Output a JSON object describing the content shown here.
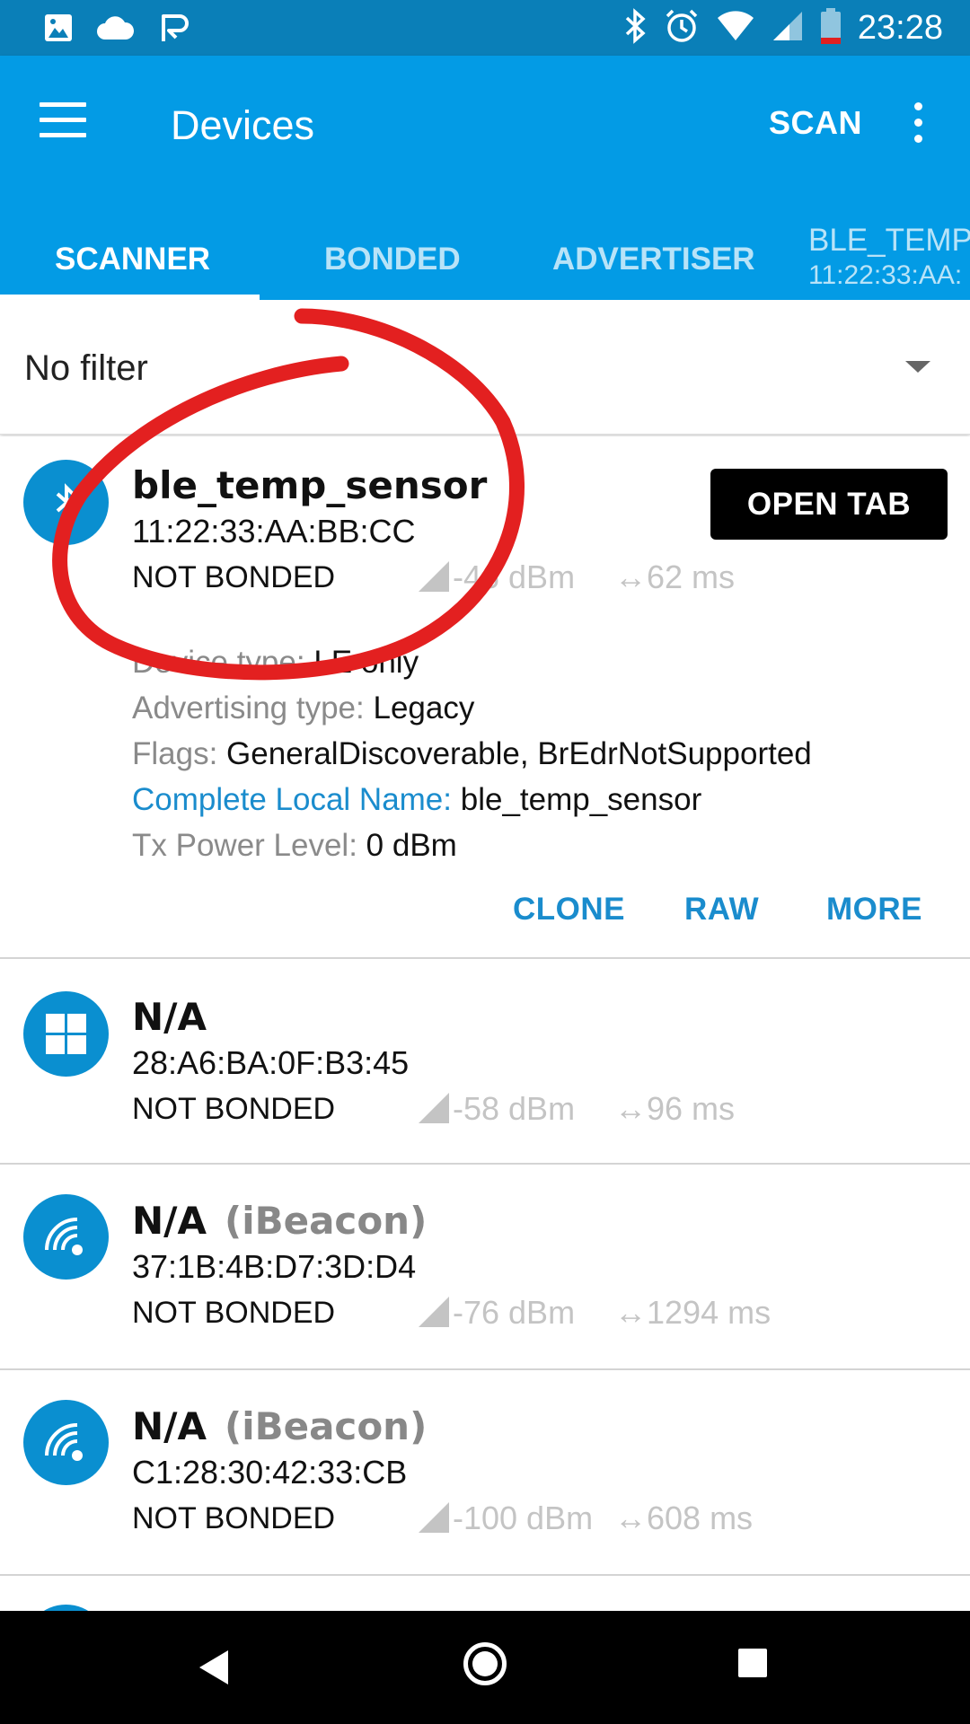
{
  "status_bar": {
    "time": "23:28",
    "left_icons": [
      "image-icon",
      "cloud-icon",
      "app-icon"
    ],
    "right_icons": [
      "bluetooth-icon",
      "alarm-icon",
      "wifi-icon",
      "signal-icon",
      "battery-icon"
    ]
  },
  "app_bar": {
    "title": "Devices",
    "scan_label": "SCAN"
  },
  "tabs": [
    {
      "label": "SCANNER",
      "active": true
    },
    {
      "label": "BONDED",
      "active": false
    },
    {
      "label": "ADVERTISER",
      "active": false
    },
    {
      "label": "BLE_TEMP_",
      "sublabel": "11:22:33:AA:",
      "active": false
    }
  ],
  "filter": {
    "label": "No filter"
  },
  "devices": [
    {
      "name": "ble_temp_sensor",
      "mac": "11:22:33:AA:BB:CC",
      "bond": "NOT BONDED",
      "rssi": "-46 dBm",
      "interval": "↔62 ms",
      "icon": "bluetooth-icon",
      "open_tab_label": "OPEN TAB",
      "details": {
        "device_type_label": "Device type:",
        "device_type_value": "LE only",
        "adv_type_label": "Advertising type:",
        "adv_type_value": "Legacy",
        "flags_label": "Flags:",
        "flags_value": "GeneralDiscoverable, BrEdrNotSupported",
        "local_name_label": "Complete Local Name:",
        "local_name_value": "ble_temp_sensor",
        "tx_label": "Tx Power Level:",
        "tx_value": "0 dBm"
      },
      "actions": {
        "clone": "CLONE",
        "raw": "RAW",
        "more": "MORE"
      }
    },
    {
      "name": "N/A",
      "mac": "28:A6:BA:0F:B3:45",
      "bond": "NOT BONDED",
      "rssi": "-58 dBm",
      "interval": "↔96 ms",
      "icon": "windows-icon"
    },
    {
      "name": "N/A",
      "tag": "(iBeacon)",
      "mac": "37:1B:4B:D7:3D:D4",
      "bond": "NOT BONDED",
      "rssi": "-76 dBm",
      "interval": "↔1294 ms",
      "icon": "beacon-icon"
    },
    {
      "name": "N/A",
      "tag": "(iBeacon)",
      "mac": "C1:28:30:42:33:CB",
      "bond": "NOT BONDED",
      "rssi": "-100 dBm",
      "interval": "↔608 ms",
      "icon": "beacon-icon"
    }
  ],
  "colors": {
    "status_bar": "#0a7fb8",
    "app_bar": "#039be5",
    "accent": "#1a8ccd",
    "annotation": "#e32020"
  }
}
